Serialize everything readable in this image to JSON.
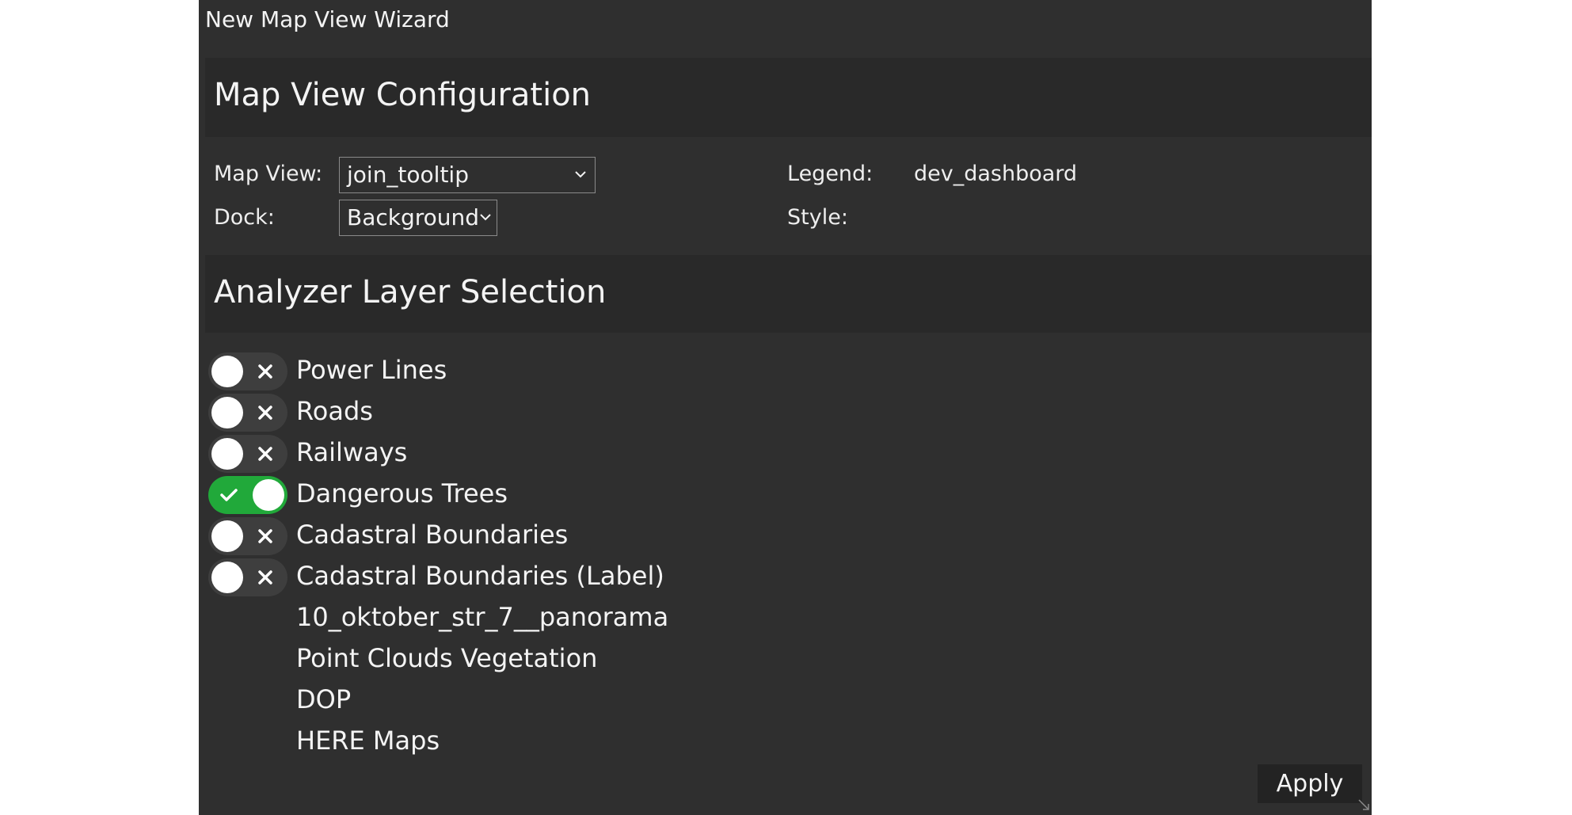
{
  "window": {
    "title": "New Map View Wizard"
  },
  "config": {
    "heading": "Map View Configuration",
    "map_view_label": "Map View:",
    "map_view_value": "join_tooltip",
    "dock_label": "Dock:",
    "dock_value": "Background",
    "legend_label": "Legend:",
    "legend_value": "dev_dashboard",
    "style_label": "Style:"
  },
  "layers": {
    "heading": "Analyzer Layer Selection",
    "items": [
      {
        "label": "Power Lines",
        "toggle": "off"
      },
      {
        "label": "Roads",
        "toggle": "off"
      },
      {
        "label": "Railways",
        "toggle": "off"
      },
      {
        "label": "Dangerous Trees",
        "toggle": "on"
      },
      {
        "label": "Cadastral Boundaries",
        "toggle": "off"
      },
      {
        "label": "Cadastral Boundaries (Label)",
        "toggle": "off"
      },
      {
        "label": "10_oktober_str_7__panorama",
        "toggle": "none"
      },
      {
        "label": "Point Clouds Vegetation",
        "toggle": "none"
      },
      {
        "label": "DOP",
        "toggle": "none"
      },
      {
        "label": "HERE Maps",
        "toggle": "none"
      }
    ]
  },
  "footer": {
    "apply_label": "Apply"
  },
  "colors": {
    "dialog_bg": "#2f2f2f",
    "section_bg": "#292929",
    "toggle_on": "#21a93a",
    "toggle_off": "#3e3e3e"
  },
  "icons": {
    "dropdown": "chevron-down-icon",
    "toggle_off": "x-icon",
    "toggle_on": "check-icon",
    "resize": "resize-handle-icon"
  }
}
